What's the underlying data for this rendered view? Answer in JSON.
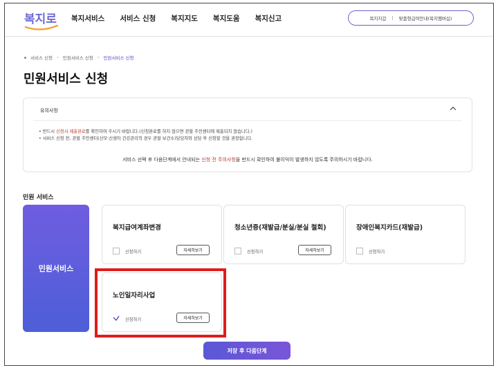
{
  "header": {
    "logo_text": "복지로",
    "nav": [
      "복지서비스",
      "서비스 신청",
      "복지지도",
      "복지도움",
      "복지신고"
    ],
    "util_links": [
      "복지지갑",
      "맞춤형급여안내(복지멤버십)"
    ]
  },
  "breadcrumb": [
    "서비스 신청",
    "민원서비스 신청",
    "민원서비스 신청"
  ],
  "page_title": "민원서비스 신청",
  "notice": {
    "title": "유의사항",
    "toggle_icon": "chevron-up",
    "line1_pre": "• 반드시 ",
    "line1_red": "신청서 제출완료",
    "line1_post": "를 확인하여 주시기 바랍니다.(신청완료를 하지 않으면 관할 주민센터에 제출되지 않습니다.)",
    "line2": "• 서비스 신청 전, 관할 주민센터(산모·신생아 건강관리의 경우 관할 보건소)담당자와 상담 후 신청할 것을 권장합니다.",
    "bottom_pre": "서비스 선택 후 다음단계에서 안내되는 ",
    "bottom_red": "신청 전 주의사항",
    "bottom_post": "을 반드시 확인하여 불이익이 발생하지 않도록 주의하시기 바랍니다."
  },
  "section_label": "민원 서비스",
  "side_card_label": "민원서비스",
  "services": [
    {
      "name": "복지급여계좌변경",
      "check_label": "신청하기",
      "detail_label": "자세히보기",
      "checked": false
    },
    {
      "name": "청소년증(재발급/분실/분실 철회)",
      "check_label": "신청하기",
      "detail_label": "자세히보기",
      "checked": false
    },
    {
      "name": "장애인복지카드(재발급)",
      "check_label": "신청하기",
      "detail_label": "",
      "checked": false
    },
    {
      "name": "노인일자리사업",
      "check_label": "신청하기",
      "detail_label": "자세히보기",
      "checked": true
    }
  ],
  "next_button": "저장 후 다음단계",
  "colors": {
    "accent": "#5a48c9",
    "highlight": "#e01b1b",
    "notice_red": "#c0392b"
  }
}
